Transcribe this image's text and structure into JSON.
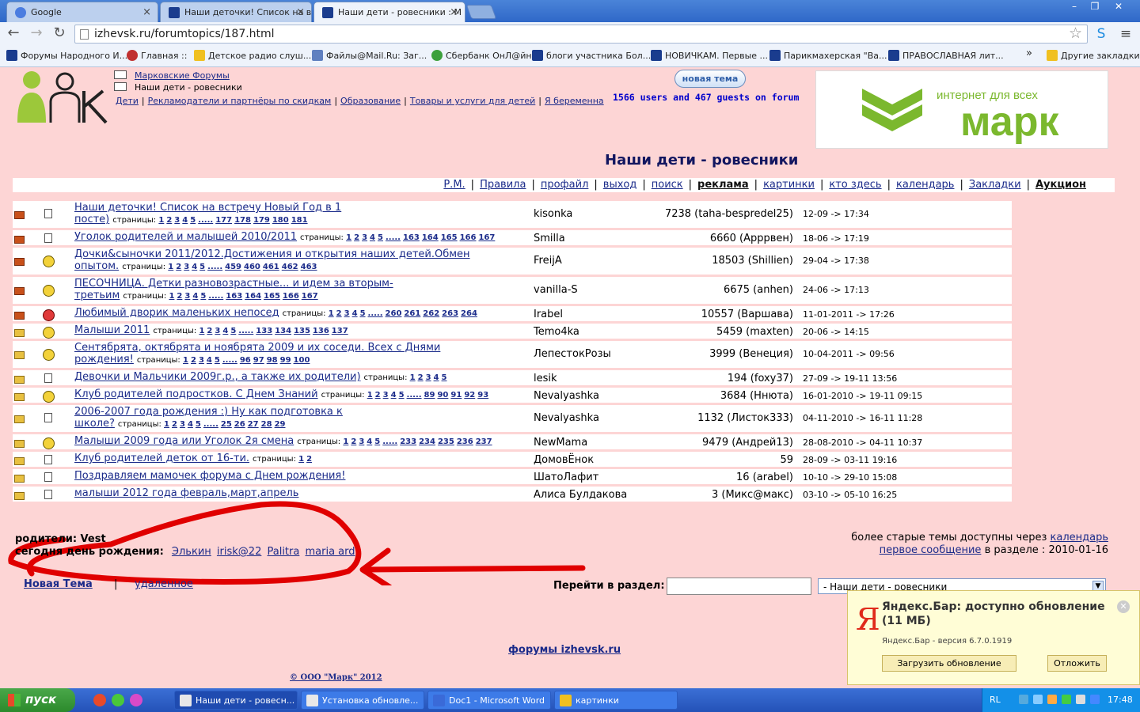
{
  "browser": {
    "tabs": [
      {
        "title": "Google",
        "active": false
      },
      {
        "title": "Наши деточки! Список на в",
        "active": false
      },
      {
        "title": "Наши дети - ровесники : M",
        "active": true
      }
    ],
    "url": "izhevsk.ru/forumtopics/187.html",
    "bookmarks": [
      "Форумы Народного И...",
      "Главная ::",
      "Детское радио слуш...",
      "Файлы@Mail.Ru: Заг...",
      "Сбербанк ОнЛ@йн",
      "блоги участника Бол...",
      "НОВИЧКАМ. Первые ...",
      "Парикмахерская \"Ва...",
      "ПРАВОСЛАВНАЯ лит..."
    ],
    "bookmarks_more": "»",
    "other_bookmarks": "Другие закладки"
  },
  "header": {
    "crumb1": "Марковские Форумы",
    "crumb2": "Наши дети - ровесники",
    "nav": [
      "Дети",
      "Рекламодатели и партнёры по скидкам",
      "Образование",
      "Товары и услуги для детей",
      "Я беременна"
    ],
    "new_topic_btn": "новая тема",
    "online": "1566 users and 467 guests on forum",
    "banner_tagline": "интернет для всех",
    "banner_brand": "марк"
  },
  "forum_title": "Наши дети - ровесники",
  "menu": [
    "Р.М.",
    "Правила",
    "профайл",
    "выход",
    "поиск",
    "реклама",
    "картинки",
    "кто здесь",
    "календарь",
    "Закладки",
    "Аукцион"
  ],
  "pages_label": "страницы:",
  "topics": [
    {
      "line1": "Наши деточки! Список на встречу Новый Год в 1",
      "line2": "посте)",
      "pages": [
        "1",
        "2",
        "3",
        "4",
        "5",
        ".....",
        "177",
        "178",
        "179",
        "180",
        "181"
      ],
      "author": "kisonka",
      "replies": "7238 (taha-bespredel25)",
      "date": "12-09 -> 17:34",
      "icon": "doc",
      "folder": "hot"
    },
    {
      "line1": "Уголок родителей и малышей 2010/2011",
      "line2": "",
      "pages": [
        "1",
        "2",
        "3",
        "4",
        "5",
        ".....",
        "163",
        "164",
        "165",
        "166",
        "167"
      ],
      "author": "Smilla",
      "replies": "6660 (Арррвен)",
      "date": "18-06 -> 17:19",
      "icon": "doc",
      "folder": "hot"
    },
    {
      "line1": "Дочки&сыночки 2011/2012.Достижения и открытия наших детей.Обмен",
      "line2": "опытом.",
      "pages": [
        "1",
        "2",
        "3",
        "4",
        "5",
        ".....",
        "459",
        "460",
        "461",
        "462",
        "463"
      ],
      "author": "FreijA",
      "replies": "18503 (Shillien)",
      "date": "29-04 -> 17:38",
      "icon": "smile",
      "folder": "hot"
    },
    {
      "line1": "ПЕСОЧНИЦА. Детки разновозрастные... и идем за вторым-",
      "line2": "третьим",
      "pages": [
        "1",
        "2",
        "3",
        "4",
        "5",
        ".....",
        "163",
        "164",
        "165",
        "166",
        "167"
      ],
      "author": "vanilla-S",
      "replies": "6675 (anhen)",
      "date": "24-06 -> 17:13",
      "icon": "smile",
      "folder": "hot"
    },
    {
      "line1": "Любимый дворик маленьких непосед",
      "line2": "",
      "pages": [
        "1",
        "2",
        "3",
        "4",
        "5",
        ".....",
        "260",
        "261",
        "262",
        "263",
        "264"
      ],
      "author": "Irabel",
      "replies": "10557 (Варшава)",
      "date": "11-01-2011 -> 17:26",
      "icon": "angry",
      "folder": "hot"
    },
    {
      "line1": "Малыши 2011",
      "line2": "",
      "pages": [
        "1",
        "2",
        "3",
        "4",
        "5",
        ".....",
        "133",
        "134",
        "135",
        "136",
        "137"
      ],
      "author": "Temo4ka",
      "replies": "5459 (maxten)",
      "date": "20-06 -> 14:15",
      "icon": "smile",
      "folder": "new"
    },
    {
      "line1": "Сентябрята, октябрята и ноябрята 2009 и их соседи. Всех с Днями",
      "line2": "рождения!",
      "pages": [
        "1",
        "2",
        "3",
        "4",
        "5",
        ".....",
        "96",
        "97",
        "98",
        "99",
        "100"
      ],
      "author": "ЛепестокРозы",
      "replies": "3999 (Венеция)",
      "date": "10-04-2011 -> 09:56",
      "icon": "smile",
      "folder": "new"
    },
    {
      "line1": "Девочки и Мальчики 2009г.р., а также их родители)",
      "line2": "",
      "pages": [
        "1",
        "2",
        "3",
        "4",
        "5"
      ],
      "author": "lesik",
      "replies": "194 (foxy37)",
      "date": "27-09 -> 19-11 13:56",
      "icon": "doc",
      "folder": "new"
    },
    {
      "line1": "Клуб родителей подростков. С Днем Знаний",
      "line2": "",
      "pages": [
        "1",
        "2",
        "3",
        "4",
        "5",
        ".....",
        "89",
        "90",
        "91",
        "92",
        "93"
      ],
      "author": "Nevalyashka",
      "replies": "3684 (Ннюта)",
      "date": "16-01-2010 -> 19-11 09:15",
      "icon": "smile",
      "folder": "new"
    },
    {
      "line1": "2006-2007 года рождения :) Ну как подготовка к",
      "line2": "школе?",
      "pages": [
        "1",
        "2",
        "3",
        "4",
        "5",
        ".....",
        "25",
        "26",
        "27",
        "28",
        "29"
      ],
      "author": "Nevalyashka",
      "replies": "1132 (Листок333)",
      "date": "04-11-2010 -> 16-11 11:28",
      "icon": "doc",
      "folder": "new"
    },
    {
      "line1": "Малыши 2009 года или Уголок 2я смена",
      "line2": "",
      "pages": [
        "1",
        "2",
        "3",
        "4",
        "5",
        ".....",
        "233",
        "234",
        "235",
        "236",
        "237"
      ],
      "author": "NewMama",
      "replies": "9479 (Андрей13)",
      "date": "28-08-2010 -> 04-11 10:37",
      "icon": "smile",
      "folder": "new"
    },
    {
      "line1": "Клуб родителей деток от 16-ти.",
      "line2": "",
      "pages": [
        "1",
        "2"
      ],
      "author": "ДомовЁнок",
      "replies": "59",
      "date": "28-09 -> 03-11 19:16",
      "icon": "doc",
      "folder": "new"
    },
    {
      "line1": "Поздравляем мамочек форума с Днем рождения!",
      "line2": "",
      "pages": [],
      "author": "ШатоЛафит",
      "replies": "16 (arabel)",
      "date": "10-10 -> 29-10 15:08",
      "icon": "doc",
      "folder": "new"
    },
    {
      "line1": "малыши 2012 года февраль,март,апрель",
      "line2": "",
      "pages": [],
      "author": "Алиса Булдакова",
      "replies": "3 (Микс@макс)",
      "date": "03-10 -> 05-10 16:25",
      "icon": "doc",
      "folder": "lock"
    }
  ],
  "readers": "родители: Vest",
  "birthdays": {
    "label": "сегодня день рождения:",
    "names": [
      "Элькин",
      "irisk@22",
      "Palitra",
      "maria ard"
    ]
  },
  "older": {
    "text": "более старые темы доступны через",
    "calendar": "календарь",
    "first_msg": "первое сообщение",
    "in_section": "в разделе :",
    "date": "2010-01-16"
  },
  "bottom": {
    "new_topic": "Новая Тема",
    "sep": "|",
    "deleted": "удаленное",
    "jump_label": "Перейти в раздел:",
    "jump_select": "- Наши дети - ровесники",
    "footer_link": "форумы izhevsk.ru",
    "copyright": "© ООО \"Марк\" 2012"
  },
  "popup": {
    "title": "Яндекс.Бар: доступно обновление (11 МБ)",
    "version": "Яндекс.Бар - версия 6.7.0.1919",
    "install": "Загрузить обновление",
    "later": "Отложить"
  },
  "taskbar": {
    "start": "пуск",
    "tasks": [
      "Наши дети - ровесн...",
      "Установка обновле...",
      "Doc1 - Microsoft Word",
      "картинки"
    ],
    "lang": "RL",
    "clock": "17:48"
  },
  "colors": {
    "page_bg": "#fdd5d5",
    "link": "#1b2b8a",
    "annotation": "#e00000"
  }
}
